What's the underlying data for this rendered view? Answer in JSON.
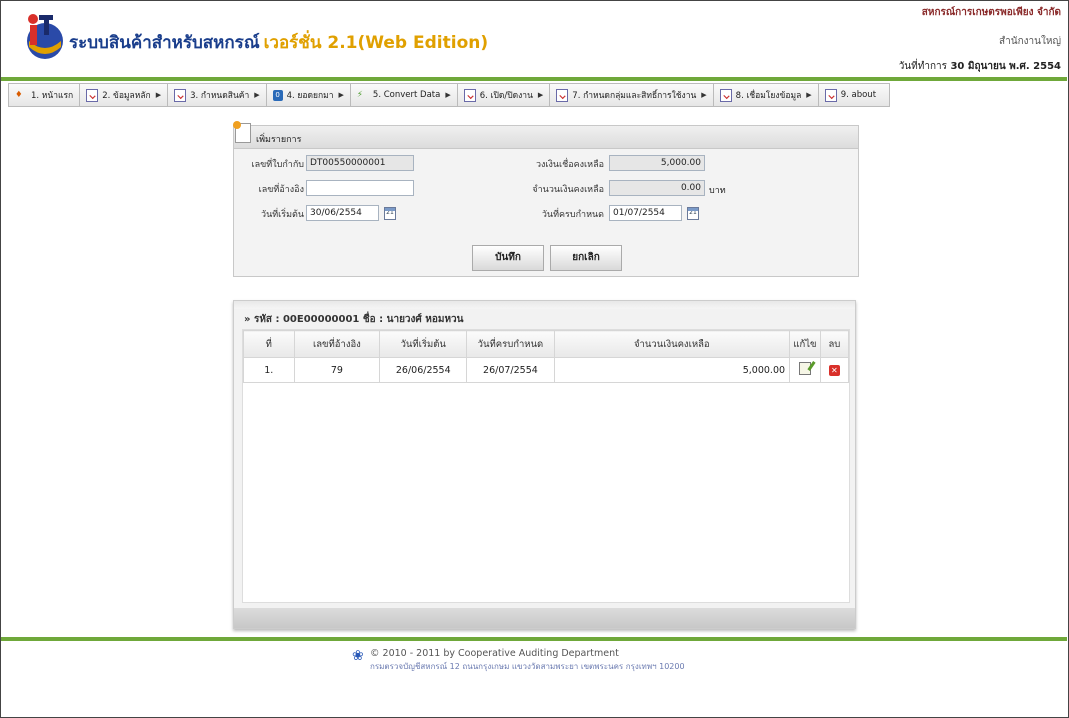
{
  "header": {
    "title": "ระบบสินค้าสำหรับสหกรณ์",
    "version": "เวอร์ชั่น 2.1(Web Edition)",
    "coop_name": "สหกรณ์การเกษตรพอเพียง จำกัด",
    "branch": "สำนักงานใหญ่",
    "work_date_label": "วันที่ทำการ",
    "work_date": "30 มิถุนายน พ.ศ. 2554"
  },
  "menu": [
    {
      "label": "1. หน้าแรก",
      "icon": "home-icon",
      "arrow": false
    },
    {
      "label": "2. ข้อมูลหลัก",
      "icon": "checklist-icon",
      "arrow": true
    },
    {
      "label": "3. กำหนดสินค้า",
      "icon": "checklist-icon",
      "arrow": true
    },
    {
      "label": "4. ยอดยกมา",
      "icon": "info-icon",
      "arrow": true
    },
    {
      "label": "5. Convert Data",
      "icon": "plug-icon",
      "arrow": true
    },
    {
      "label": "6. เปิด/ปิดงาน",
      "icon": "checklist-icon",
      "arrow": true
    },
    {
      "label": "7. กำหนดกลุ่มและสิทธิ์การใช้งาน",
      "icon": "checklist-icon",
      "arrow": true
    },
    {
      "label": "8. เชื่อมโยงข้อมูล",
      "icon": "checklist-icon",
      "arrow": true
    },
    {
      "label": "9. about",
      "icon": "checklist-icon",
      "arrow": false
    }
  ],
  "form": {
    "title": "เพิ่มรายการ",
    "invoice_label": "เลขที่ใบกำกับ",
    "invoice_value": "DT00550000001",
    "ref_label": "เลขที่อ้างอิง",
    "ref_value": "",
    "start_label": "วันที่เริ่มต้น",
    "start_value": "30/06/2554",
    "credit_label": "วงเงินเชื่อคงเหลือ",
    "credit_value": "5,000.00",
    "balance_label": "จำนวนเงินคงเหลือ",
    "balance_value": "0.00",
    "balance_unit": "บาท",
    "due_label": "วันที่ครบกำหนด",
    "due_value": "01/07/2554",
    "cal_text": "21",
    "save_label": "บันทึก",
    "cancel_label": "ยกเลิก"
  },
  "grid": {
    "title": "» รหัส : 00E00000001 ชื่อ : นายวงศ์ หอมหวน",
    "columns": [
      "ที่",
      "เลขที่อ้างอิง",
      "วันที่เริ่มต้น",
      "วันที่ครบกำหนด",
      "จำนวนเงินคงเหลือ",
      "แก้ไข",
      "ลบ"
    ],
    "rows": [
      {
        "no": "1.",
        "ref": "79",
        "start": "26/06/2554",
        "due": "26/07/2554",
        "amount": "5,000.00"
      }
    ]
  },
  "footer": {
    "copyright": "© 2010 - 2011  by Cooperative Auditing Department",
    "address": "กรมตรวจบัญชีสหกรณ์ 12 ถนนกรุงเกษม แขวงวัดสามพระยา เขตพระนคร กรุงเทพฯ 10200"
  },
  "colors": {
    "accent_green": "#6fa83a",
    "title_blue": "#1a3e8c",
    "version_orange": "#e0a000"
  }
}
